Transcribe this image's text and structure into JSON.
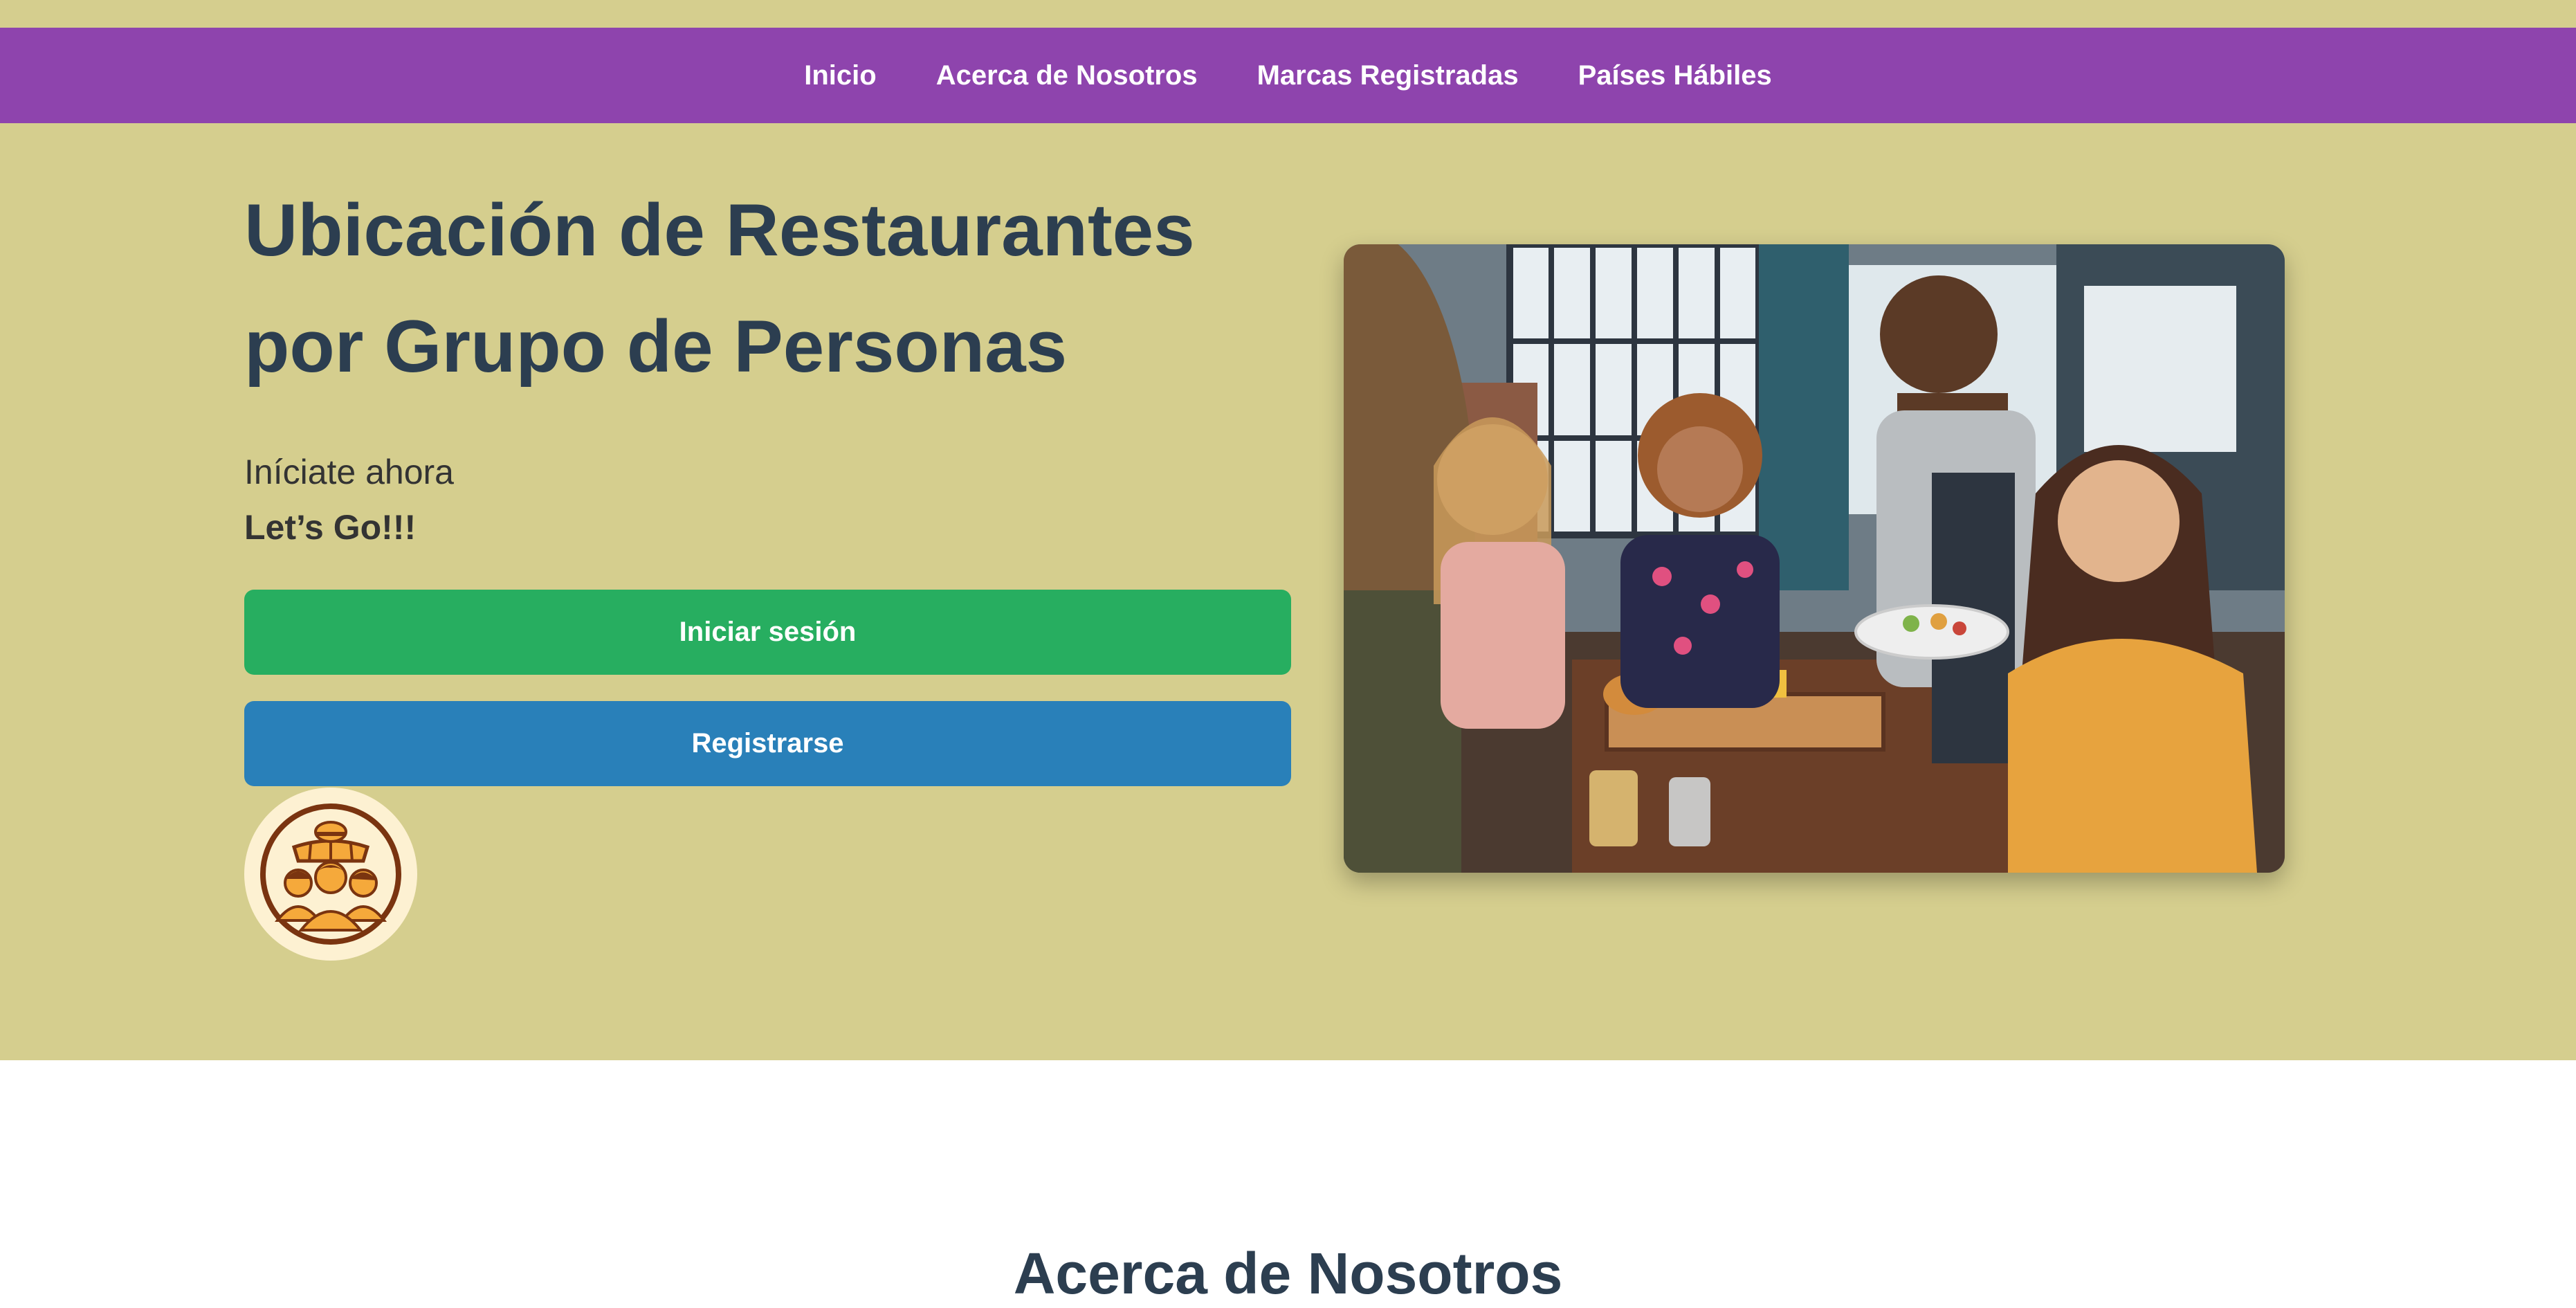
{
  "nav": {
    "items": [
      {
        "label": "Inicio"
      },
      {
        "label": "Acerca de Nosotros"
      },
      {
        "label": "Marcas Registradas"
      },
      {
        "label": "Países Hábiles"
      }
    ]
  },
  "hero": {
    "title_line1": "Ubicación de Restaurantes",
    "title_line2": "por Grupo de Personas",
    "subtitle": "Iníciate ahora",
    "tagline": "Let’s Go!!!",
    "login_label": "Iniciar sesión",
    "register_label": "Registrarse"
  },
  "about": {
    "title": "Acerca de Nosotros"
  },
  "colors": {
    "background": "#d5ce8e",
    "nav": "#8e44ad",
    "login": "#27ae60",
    "register": "#2980b9",
    "heading": "#2c3e50"
  },
  "icons": {
    "logo": "restaurant-group-logo-icon"
  }
}
